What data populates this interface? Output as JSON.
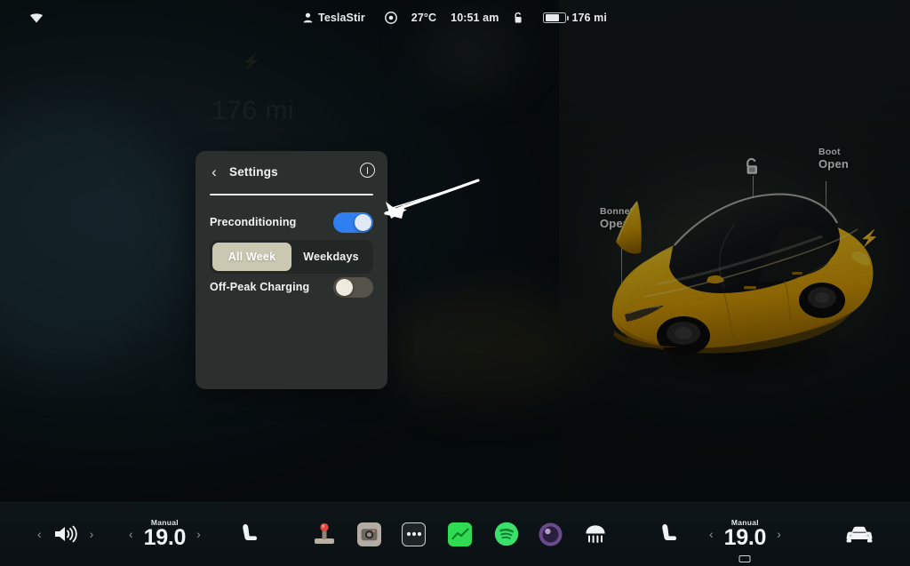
{
  "status_bar": {
    "wifi_icon": "wifi-icon",
    "profile_icon": "person-icon",
    "profile_name": "TeslaStir",
    "climate_icon": "fan-circle-icon",
    "temperature": "27°C",
    "clock": "10:51 am",
    "lock_icon": "unlocked-padlock-icon",
    "battery_icon": "battery-icon",
    "range": "176 mi"
  },
  "background": {
    "ghost_range": "176 mi",
    "ghost_bolt_icon": "bolt-icon"
  },
  "settings_card": {
    "back_icon": "chevron-left-icon",
    "title": "Settings",
    "info_icon": "info-circle-icon",
    "preconditioning": {
      "label": "Preconditioning",
      "toggle_state": "on",
      "toggle_color": "#2f7ff0"
    },
    "schedule": {
      "options": [
        "All Week",
        "Weekdays"
      ],
      "selected": "All Week",
      "active_color": "#cbc8b2"
    },
    "off_peak": {
      "label": "Off-Peak Charging",
      "toggle_state": "off",
      "toggle_color": "#56544a"
    }
  },
  "annotation": {
    "arrow_icon": "arrow-pointing-left",
    "color": "#ffffff"
  },
  "car_view": {
    "car_color": "#f6c71a",
    "lock_icon": "unlocked-padlock-icon",
    "charge_icon": "bolt-icon",
    "labels": [
      {
        "name": "Bonnet",
        "state": "Open"
      },
      {
        "name": "Boot",
        "state": "Open"
      }
    ]
  },
  "bottom_bar": {
    "volume": {
      "prev_icon": "chevron-left-icon",
      "speaker_icon": "volume-icon",
      "next_icon": "chevron-right-icon"
    },
    "driver_climate": {
      "prev_icon": "chevron-left-icon",
      "mode": "Manual",
      "value": "19.0",
      "next_icon": "chevron-right-icon"
    },
    "driver_seat_icon": "seat-heater-icon",
    "apps": [
      {
        "icon": "arcade-joystick-icon",
        "label": "Arcade"
      },
      {
        "icon": "camera-icon",
        "label": "Camera"
      },
      {
        "icon": "more-dots-icon",
        "label": "More"
      },
      {
        "icon": "energy-graph-icon",
        "label": "Energy"
      },
      {
        "icon": "spotify-icon",
        "label": "Spotify"
      },
      {
        "icon": "media-orb-icon",
        "label": "Media"
      },
      {
        "icon": "rear-defrost-icon",
        "label": "Rear Defrost"
      }
    ],
    "passenger_seat_icon": "seat-heater-icon",
    "passenger_climate": {
      "prev_icon": "chevron-left-icon",
      "mode": "Manual",
      "value": "19.0",
      "next_icon": "chevron-right-icon",
      "sub_icon": "windshield-defrost-icon"
    },
    "car_controls_icon": "car-front-icon"
  }
}
